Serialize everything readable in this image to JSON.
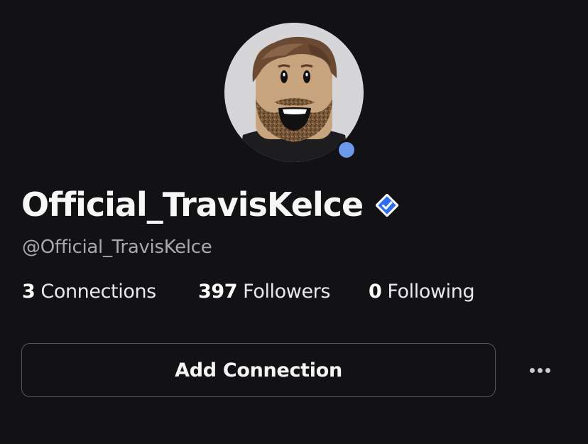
{
  "profile": {
    "display_name": "Official_TravisKelce",
    "username": "@Official_TravisKelce",
    "verified": true,
    "online_status": "online",
    "avatar_icon": "bearded-avatar-icon"
  },
  "stats": {
    "connections_count": "3",
    "connections_label": "Connections",
    "followers_count": "397",
    "followers_label": "Followers",
    "following_count": "0",
    "following_label": "Following"
  },
  "actions": {
    "add_connection_label": "Add Connection",
    "more_icon": "more-horizontal-icon"
  },
  "colors": {
    "background": "#121215",
    "verified_badge": "#2f6cf6",
    "presence": "#6b98ea",
    "secondary_text": "#a9a9ad"
  }
}
